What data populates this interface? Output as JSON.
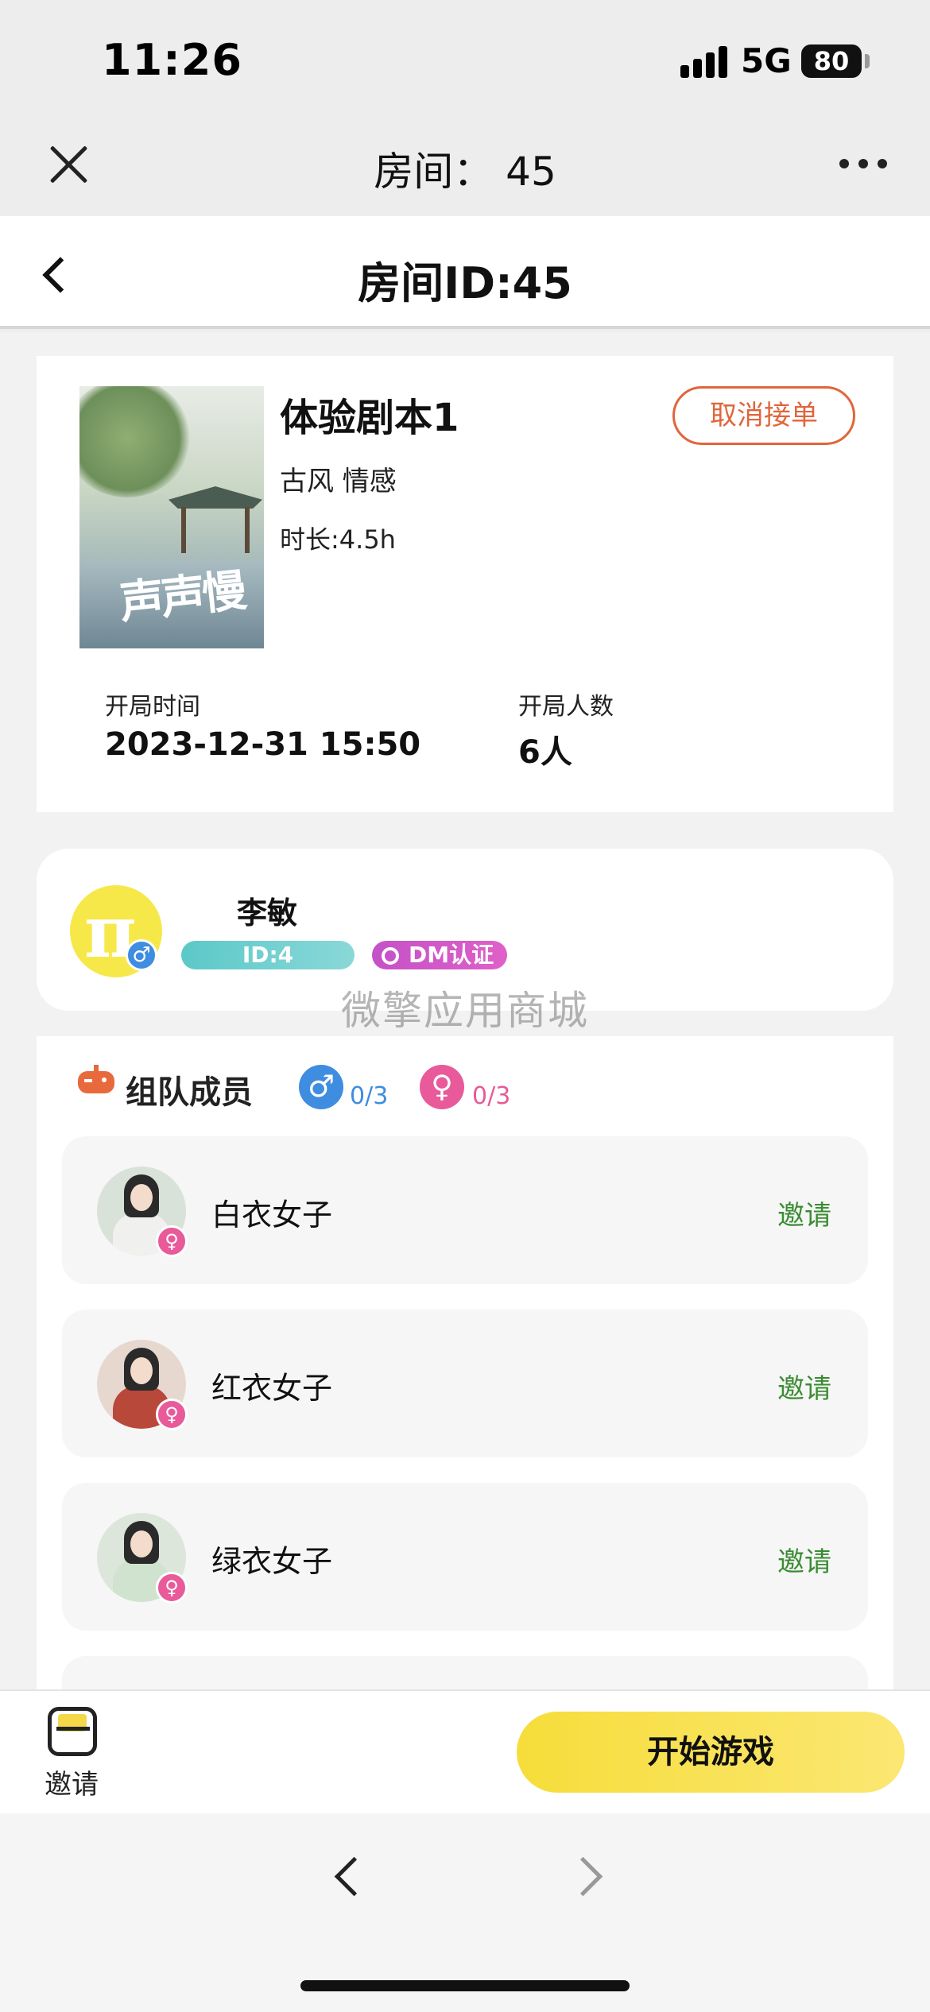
{
  "status_bar": {
    "time": "11:26",
    "network": "5G",
    "battery": "80"
  },
  "wechat_nav": {
    "title": "房间：  45"
  },
  "header": {
    "title": "房间ID:45"
  },
  "script": {
    "name": "体验剧本1",
    "tags": "古风 情感",
    "duration": "时长:4.5h",
    "cancel_label": "取消接单",
    "cover_title": "声声慢"
  },
  "meta": {
    "start_time_label": "开局时间",
    "start_time_value": "2023-12-31 15:50",
    "players_label": "开局人数",
    "players_value": "6人"
  },
  "dm": {
    "name": "李敏",
    "id_label": "ID:4",
    "badge_label": "DM认证",
    "gender_symbol": "♂"
  },
  "watermark": "微擎应用商城",
  "team": {
    "title": "组队成员",
    "male_symbol": "♂",
    "male_count": "0/3",
    "female_symbol": "♀",
    "female_count": "0/3",
    "members": [
      {
        "name": "白衣女子",
        "action": "邀请",
        "robe_color": "#f0f0ee"
      },
      {
        "name": "红衣女子",
        "action": "邀请",
        "robe_color": "#b8483a"
      },
      {
        "name": "绿衣女子",
        "action": "邀请",
        "robe_color": "#cfe3cf"
      }
    ]
  },
  "bottom": {
    "invite_label": "邀请",
    "start_label": "开始游戏"
  },
  "colors": {
    "accent_orange": "#e0653b",
    "invite_green": "#3a8c32",
    "start_yellow": "#f6dd3a",
    "male_blue": "#3f8de0",
    "female_pink": "#e85a9a"
  }
}
